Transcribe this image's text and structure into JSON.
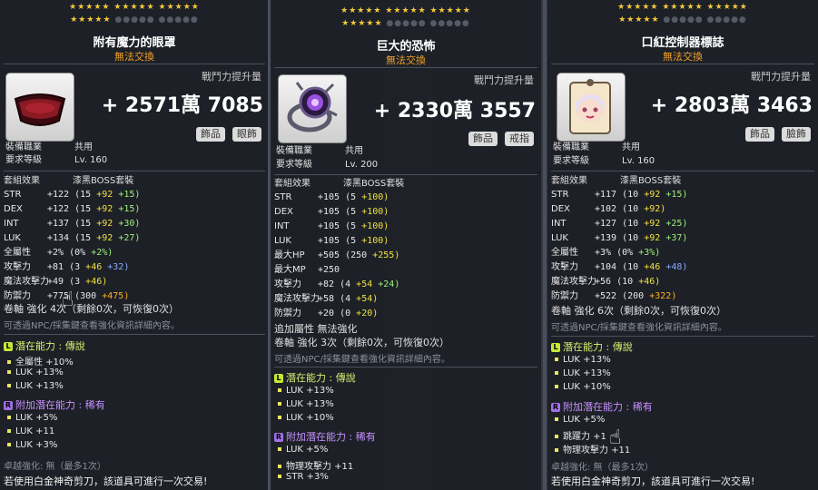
{
  "panels": [
    {
      "title": "附有魔力的眼罩",
      "trade": "無法交換",
      "bp_label": "戰鬥力提升量",
      "bp_value": "+ 2571萬 7085",
      "tags": [
        "飾品",
        "眼飾"
      ],
      "job_label": "裝備職業",
      "job_value": "共用",
      "level_label": "要求等級",
      "level_value": "Lv. 160",
      "set_label": "套組效果",
      "set_value": "漆黑BOSS套裝",
      "stats": [
        {
          "label": "STR",
          "base": "+122",
          "mid": "(15",
          "y": "+92",
          "g": "+15)"
        },
        {
          "label": "DEX",
          "base": "+122",
          "mid": "(15",
          "y": "+92",
          "g": "+15)"
        },
        {
          "label": "INT",
          "base": "+137",
          "mid": "(15",
          "y": "+92",
          "g": "+30)"
        },
        {
          "label": "LUK",
          "base": "+134",
          "mid": "(15",
          "y": "+92",
          "g": "+27)"
        },
        {
          "label": "全屬性",
          "base": "+2%",
          "mid": "(0%",
          "y": "",
          "g": "+2%)"
        },
        {
          "label": "攻擊力",
          "base": "+81",
          "mid": "(3",
          "y": "+46",
          "b": "+32)"
        },
        {
          "label": "魔法攻擊力",
          "base": "+49",
          "mid": "(3",
          "y": "+46)",
          "g": ""
        },
        {
          "label": "防禦力",
          "base": "+775",
          "mid": "(300",
          "y": "",
          "o": "+475)"
        }
      ],
      "scroll": "卷軸 強化 4次（剩餘0次，可恢復0次）",
      "hint": "可透過NPC/採集鍵查看強化資訊詳細內容。",
      "potential_title": "潛在能力 : 傳說",
      "potential_badge": "L",
      "potential": [
        "全屬性 +10%",
        "LUK +13%",
        "LUK +13%"
      ],
      "add_title": "附加潛在能力 : 稀有",
      "add_badge": "R",
      "add_potential": [
        "LUK +5%",
        "LUK +11",
        "LUK +3%"
      ],
      "star_force": "卓越強化: 無（最多1次）",
      "footer": "若使用白金神奇剪刀，該道具可進行一次交易!"
    },
    {
      "title": "巨大的恐怖",
      "trade": "無法交換",
      "bp_label": "戰鬥力提升量",
      "bp_value": "+ 2330萬 3557",
      "tags": [
        "飾品",
        "戒指"
      ],
      "job_label": "裝備職業",
      "job_value": "共用",
      "level_label": "要求等級",
      "level_value": "Lv. 200",
      "set_label": "套組效果",
      "set_value": "漆黑BOSS套裝",
      "stats": [
        {
          "label": "STR",
          "base": "+105",
          "mid": "(5",
          "y": "+100)",
          "g": ""
        },
        {
          "label": "DEX",
          "base": "+105",
          "mid": "(5",
          "y": "+100)",
          "g": ""
        },
        {
          "label": "INT",
          "base": "+105",
          "mid": "(5",
          "y": "+100)",
          "g": ""
        },
        {
          "label": "LUK",
          "base": "+105",
          "mid": "(5",
          "y": "+100)",
          "g": ""
        },
        {
          "label": "最大HP",
          "base": "+505",
          "mid": "(250",
          "y": "+255)",
          "g": ""
        },
        {
          "label": "最大MP",
          "base": "+250",
          "mid": "",
          "y": "",
          "g": ""
        },
        {
          "label": "攻擊力",
          "base": "+82",
          "mid": "(4",
          "y": "+54",
          "g": "+24)"
        },
        {
          "label": "魔法攻擊力",
          "base": "+58",
          "mid": "(4",
          "y": "+54)",
          "g": ""
        },
        {
          "label": "防禦力",
          "base": "+20",
          "mid": "(0",
          "y": "+20)",
          "g": ""
        }
      ],
      "extra": "追加屬性 無法強化",
      "scroll": "卷軸 強化 3次（剩餘0次，可恢復0次）",
      "hint": "可透過NPC/採集鍵查看強化資訊詳細內容。",
      "potential_title": "潛在能力 : 傳說",
      "potential_badge": "L",
      "potential": [
        "LUK +13%",
        "LUK +13%",
        "LUK +10%"
      ],
      "add_title": "附加潛在能力 : 稀有",
      "add_badge": "R",
      "add_potential": [
        "LUK +5%",
        "物理攻擊力 +11",
        "STR +3%"
      ],
      "footer": ""
    },
    {
      "title": "口紅控制器標誌",
      "trade": "無法交換",
      "bp_label": "戰鬥力提升量",
      "bp_value": "+ 2803萬 3463",
      "tags": [
        "飾品",
        "臉飾"
      ],
      "job_label": "裝備職業",
      "job_value": "共用",
      "level_label": "要求等級",
      "level_value": "Lv. 160",
      "set_label": "套組效果",
      "set_value": "漆黑BOSS套裝",
      "stats": [
        {
          "label": "STR",
          "base": "+117",
          "mid": "(10",
          "y": "+92",
          "g": "+15)"
        },
        {
          "label": "DEX",
          "base": "+102",
          "mid": "(10",
          "y": "+92)",
          "g": ""
        },
        {
          "label": "INT",
          "base": "+127",
          "mid": "(10",
          "y": "+92",
          "g": "+25)"
        },
        {
          "label": "LUK",
          "base": "+139",
          "mid": "(10",
          "y": "+92",
          "g": "+37)"
        },
        {
          "label": "全屬性",
          "base": "+3%",
          "mid": "(0%",
          "y": "",
          "g": "+3%)"
        },
        {
          "label": "攻擊力",
          "base": "+104",
          "mid": "(10",
          "y": "+46",
          "b": "+48)"
        },
        {
          "label": "魔法攻擊力",
          "base": "+56",
          "mid": "(10",
          "y": "+46)",
          "g": ""
        },
        {
          "label": "防禦力",
          "base": "+522",
          "mid": "(200",
          "y": "",
          "o": "+322)"
        }
      ],
      "scroll": "卷軸 強化 6次（剩餘0次，可恢復0次）",
      "hint": "可透過NPC/採集鍵查看強化資訊詳細內容。",
      "potential_title": "潛在能力 : 傳說",
      "potential_badge": "L",
      "potential": [
        "LUK +13%",
        "LUK +13%",
        "LUK +10%"
      ],
      "add_title": "附加潛在能力 : 稀有",
      "add_badge": "R",
      "add_potential": [
        "LUK +5%",
        "跳躍力 +1",
        "物理攻擊力 +11"
      ],
      "star_force": "卓越強化: 無（最多1次）",
      "footer": "若使用白金神奇剪刀，該道具可進行一次交易!"
    }
  ]
}
